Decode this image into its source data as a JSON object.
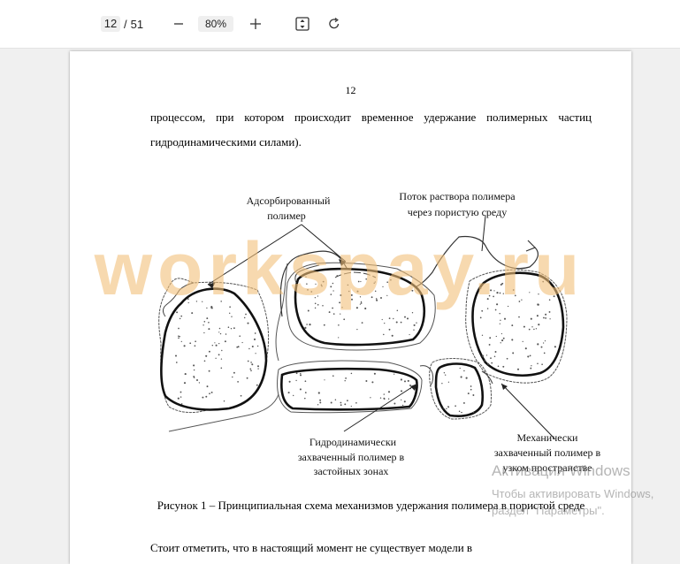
{
  "toolbar": {
    "current_page": "12",
    "page_sep": "/",
    "total_pages": "51",
    "zoom": "80%"
  },
  "document": {
    "page_number": "12",
    "para1": "процессом, при котором происходит временное удержание полимерных частиц гидродинамическими силами).",
    "figure": {
      "label_adsorbed": [
        "Адсорбированный",
        "полимер"
      ],
      "label_flow": [
        "Поток раствора полимера",
        "через пористую среду"
      ],
      "label_hydro": [
        "Гидродинамически",
        "захваченный полимер в",
        "застойных зонах"
      ],
      "label_mech": [
        "Механически",
        "захваченный полимер в",
        "узком пространстве"
      ]
    },
    "caption": "Рисунок 1 – Принципиальная схема механизмов удержания полимера в пористой среде",
    "para2": "Стоит отметить, что в настоящий момент не существует модели в"
  },
  "watermark": {
    "text": "workspay.ru",
    "color": "#f2c07a"
  },
  "windows_activation": {
    "title": "Активация Windows",
    "line1": "Чтобы активировать Windows,",
    "line2": "раздел \"Параметры\"."
  }
}
